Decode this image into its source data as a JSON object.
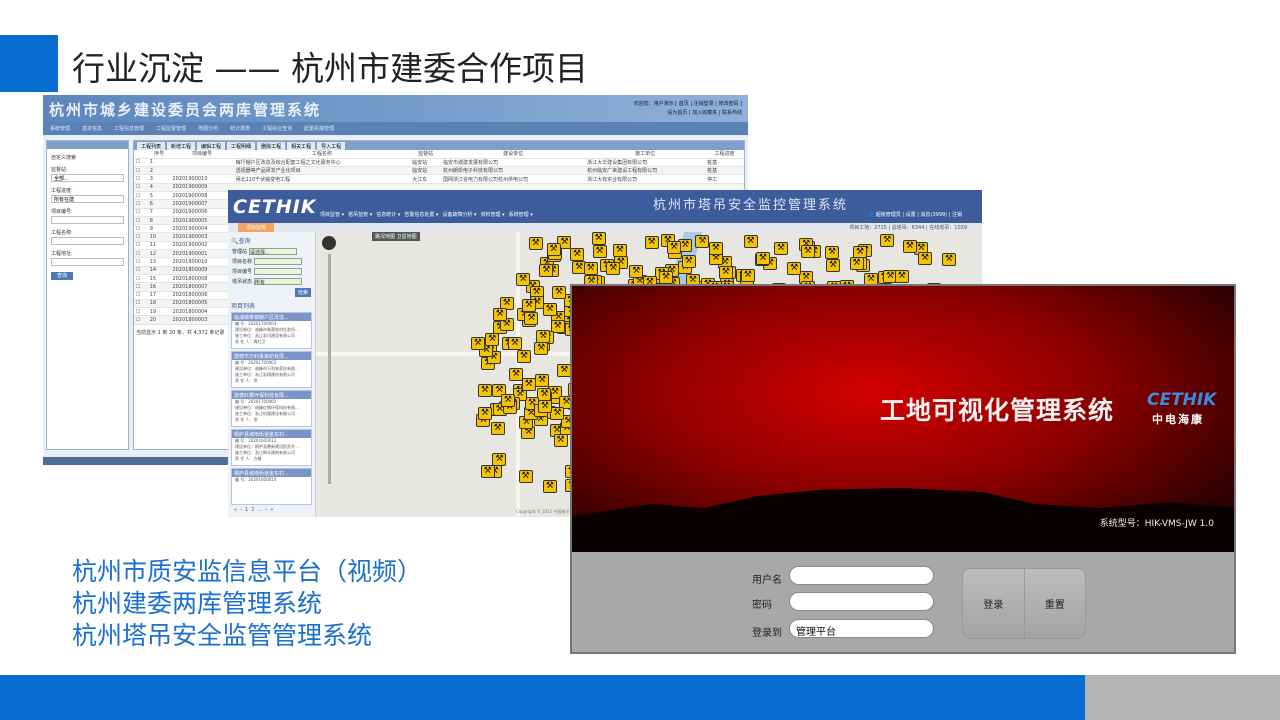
{
  "slide": {
    "title": "行业沉淀 —— 杭州市建委合作项目",
    "captions": [
      "杭州市质安监信息平台（视频）",
      "杭州建委两库管理系统",
      "杭州塔吊安全监管管理系统"
    ],
    "accent_color": "#0a6dd1"
  },
  "app1": {
    "title": "杭州市城乡建设委员会两库管理系统",
    "links": [
      "欢迎您：用户演示 [ 首页 | 注销登录 | 修改密码 ]",
      "设为首页 | 加入收藏夹 | 联系热线"
    ],
    "nav": [
      "系统管理",
      "基本信息",
      "工程信息管理",
      "工程监督管理",
      "地图分布",
      "统计报表",
      "工程综合查询",
      "起重机械管理"
    ],
    "sidebar": {
      "heading": "自定义搜索",
      "station_label": "监督站:",
      "station_value": "全部...",
      "progress_label": "工程进度:",
      "progress_value": "所有在建",
      "code_label": "项目编号:",
      "name_label": "工程名称:",
      "address_label": "工程地址:",
      "search_button": "查询"
    },
    "tabs": [
      "工程列表",
      "新增工程",
      "编辑工程",
      "工程明细",
      "删除工程",
      "相关工程",
      "导入工程"
    ],
    "columns": [
      "序号",
      "项目编号",
      "工程名称",
      "监督站",
      "建设单位",
      "施工单位",
      "工程进度"
    ],
    "rows": [
      [
        "1",
        "",
        "梅圩棚户区改造及综合配套工程之文化服务中心",
        "临安站",
        "临安市城建发展有限公司",
        "浙江大华建设集团有限公司",
        "桩基"
      ],
      [
        "2",
        "",
        "透视器等产品研发产业化项目",
        "临安站",
        "杭州朗凯电子科技有限公司",
        "杭州临安广来建设工程有限公司",
        "桩基"
      ],
      [
        "3",
        "20201900010",
        "闸北110千伏输变电工程",
        "大江东",
        "国网浙江省电力有限公司杭州供电公司",
        "浙江大有实业有限公司",
        "停工"
      ],
      [
        "4",
        "20201900009",
        "",
        "",
        "",
        "",
        ""
      ],
      [
        "5",
        "20201900008",
        "",
        "",
        "",
        "",
        ""
      ],
      [
        "6",
        "20201900007",
        "",
        "",
        "",
        "",
        ""
      ],
      [
        "7",
        "20201900006",
        "",
        "",
        "",
        "",
        ""
      ],
      [
        "8",
        "20201900005",
        "",
        "",
        "",
        "",
        ""
      ],
      [
        "9",
        "20201900004",
        "",
        "",
        "",
        "",
        ""
      ],
      [
        "10",
        "20201900003",
        "",
        "",
        "",
        "",
        ""
      ],
      [
        "11",
        "20201900002",
        "",
        "",
        "",
        "",
        ""
      ],
      [
        "12",
        "20201900001",
        "",
        "",
        "",
        "",
        ""
      ],
      [
        "13",
        "20201800010",
        "",
        "",
        "",
        "",
        ""
      ],
      [
        "14",
        "20201800009",
        "",
        "",
        "",
        "",
        ""
      ],
      [
        "15",
        "20201800008",
        "",
        "",
        "",
        "",
        ""
      ],
      [
        "16",
        "20201800007",
        "",
        "",
        "",
        "",
        ""
      ],
      [
        "17",
        "20201800006",
        "",
        "",
        "",
        "",
        ""
      ],
      [
        "18",
        "20201800005",
        "",
        "",
        "",
        "",
        ""
      ],
      [
        "19",
        "20201800004",
        "",
        "",
        "",
        "",
        ""
      ],
      [
        "20",
        "20201800003",
        "",
        "",
        "",
        "",
        ""
      ]
    ],
    "footer": "当前显示 1 到 20 条，共 4,372 条记录"
  },
  "app2": {
    "logo": "CETHIK",
    "title": "杭州市塔吊安全监控管理系统",
    "menu": [
      "项目监管 ▾",
      "塔吊监管 ▾",
      "信息统计 ▾",
      "告警信息处置 ▾",
      "设备故障分析 ▾",
      "资料管理 ▾",
      "系统管理 ▾"
    ],
    "user": "超级管理员 | 设置 | 消息(3999) | 注销",
    "breadcrumb": "项目监管",
    "stats": "项目工地：2715 | 总塔吊：6344 | 在线塔吊：1039",
    "map_types": [
      "路况地图",
      "卫星地图"
    ],
    "query": {
      "heading": "查询",
      "station_label": "管理站",
      "station_value": "请选择..",
      "name_label": "项目名称",
      "code_label": "项目编号",
      "state_label": "塔吊状态",
      "state_value": "所有",
      "search_button": "检索"
    },
    "list_heading": "项目列表",
    "projects": [
      {
        "name": "临浦镇車镇棚户区改造...",
        "code": "编    号：20201700003",
        "builder": "建设单位：逾峰市果蔬农村任务所...",
        "contractor": "施工单位：浙江彩讯建设有限公司",
        "manager": "责 任 人：周红卫"
      },
      {
        "name": "建德市万利来家纺有限...",
        "code": "编    号：20201700002",
        "builder": "建设单位：逾峰市万利来家纺有限...",
        "contractor": "施工单位：浙江彩翔建纺有限公司",
        "manager": "责 任 人：徐"
      },
      {
        "name": "建德红狮环保科技有限...",
        "code": "编    号：20201700001",
        "builder": "建设单位：逾峰红狮环保科技有限...",
        "contractor": "施工单位：浙江杭路建设有限公司",
        "manager": "责 任 人：徐"
      },
      {
        "name": "桐庐县城南街道金东村...",
        "code": "编    号：20201600011",
        "builder": "建设单位：桐庐县鼎新建设投资开...",
        "contractor": "施工单位：浙江桐丰建筑有限公司",
        "manager": "责 任 人：方敏"
      },
      {
        "name": "桐庐县城南街道金东村...",
        "code": "编    号：20201600010",
        "builder": "",
        "contractor": "",
        "manager": ""
      }
    ],
    "pager": [
      "«",
      "‹",
      "1",
      "2",
      "...",
      "›",
      "»"
    ],
    "copyright": "Copyright © 2011 中国电子科技集团公司第五十二研究所 All Rights"
  },
  "app3": {
    "title": "工地可视化管理系统",
    "logo": "CETHIK",
    "logo_cn": "中电海康",
    "model": "系统型号：HIK-VMS-JW 1.0",
    "username_label": "用户名",
    "password_label": "密码",
    "login_to_label": "登录到",
    "username_value": "",
    "password_value": "",
    "login_to_value": "管理平台",
    "login_button": "登录",
    "reset_button": "重置"
  }
}
